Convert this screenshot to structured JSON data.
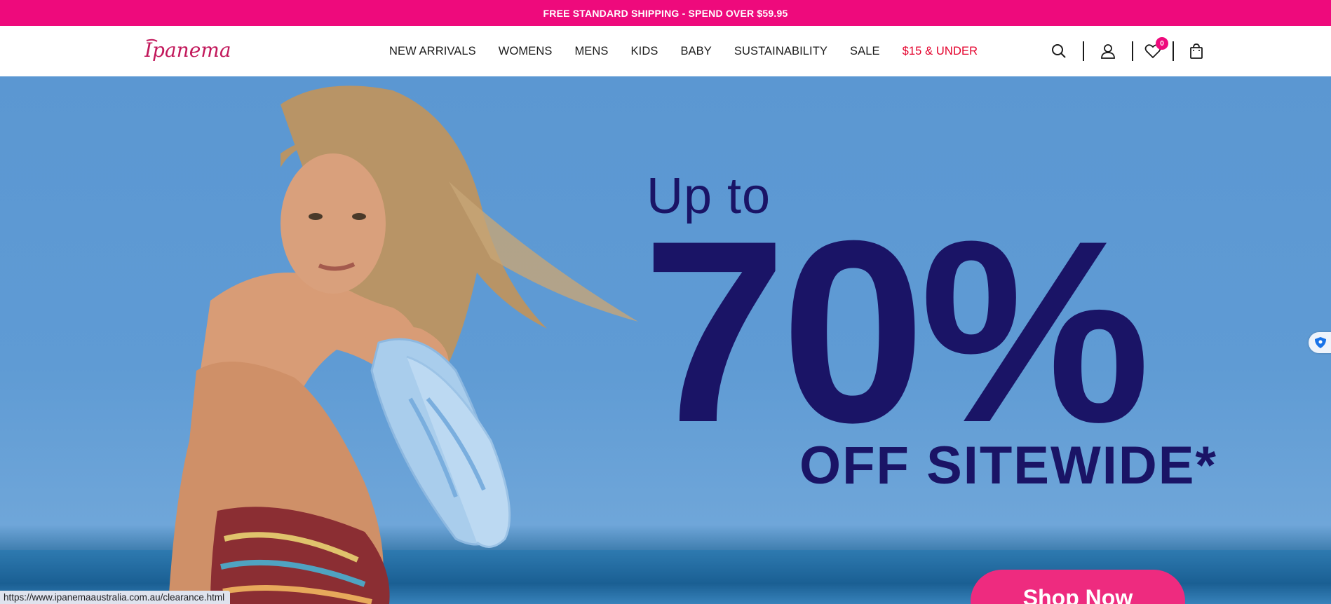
{
  "promo": {
    "text": "FREE STANDARD SHIPPING - SPEND OVER $59.95"
  },
  "header": {
    "logo_text": "Ipanema",
    "nav": [
      {
        "label": "NEW ARRIVALS"
      },
      {
        "label": "WOMENS"
      },
      {
        "label": "MENS"
      },
      {
        "label": "KIDS"
      },
      {
        "label": "BABY"
      },
      {
        "label": "SUSTAINABILITY"
      },
      {
        "label": "SALE"
      },
      {
        "label": "$15 & UNDER"
      }
    ],
    "icons": [
      "search-icon",
      "account-icon",
      "wishlist-icon",
      "bag-icon"
    ],
    "wishlist_count": "0"
  },
  "hero": {
    "line1": "Up to",
    "line2": "70%",
    "line3": "OFF SITEWIDE*",
    "cta": "Shop Now"
  },
  "status_bar": {
    "url": "https://www.ipanemaaustralia.com.au/clearance.html"
  },
  "colors": {
    "brand_pink": "#ee0a7c",
    "headline_navy": "#1a1466",
    "sale_red": "#e4002b",
    "hero_sky": "#5b97d2"
  }
}
